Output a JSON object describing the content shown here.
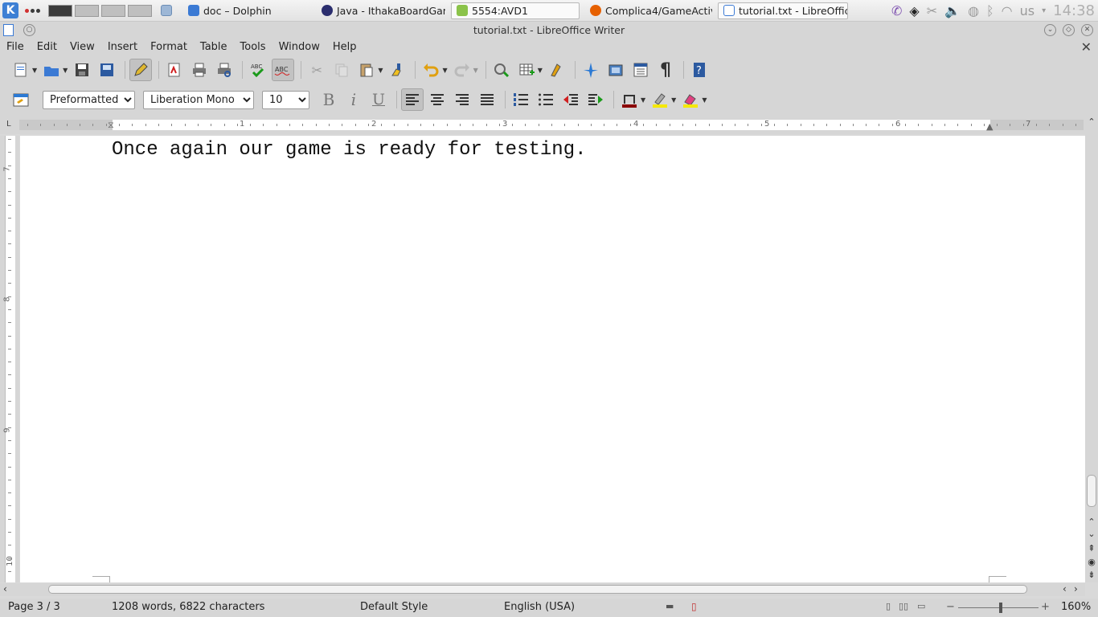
{
  "taskbar": {
    "tasks": [
      {
        "label": "doc – Dolphin",
        "icon": "folder-icon",
        "color": "#3b7ad4"
      },
      {
        "label": "Java - IthakaBoardGam",
        "icon": "eclipse-icon",
        "color": "#2b2e6e"
      },
      {
        "label": "5554:AVD1",
        "icon": "android-icon",
        "color": "#8bc34a"
      },
      {
        "label": "Complica4/GameActivi",
        "icon": "firefox-icon",
        "color": "#e66000"
      },
      {
        "label": "tutorial.txt - LibreOffic",
        "icon": "writer-icon",
        "color": "#3b7ad4"
      }
    ],
    "tray": {
      "language": "us",
      "clock": "14:38"
    }
  },
  "window": {
    "title": "tutorial.txt - LibreOffice Writer"
  },
  "menu": [
    "File",
    "Edit",
    "View",
    "Insert",
    "Format",
    "Table",
    "Tools",
    "Window",
    "Help"
  ],
  "formatting": {
    "paragraph_style": "Preformatted Te",
    "font_name": "Liberation Mono",
    "font_size": "10"
  },
  "ruler": {
    "horizontal_numbers": [
      "1",
      "2",
      "3",
      "4",
      "5",
      "6",
      "7"
    ],
    "vertical_numbers": [
      "7",
      "8",
      "9",
      "10"
    ]
  },
  "document": {
    "line": "Once again our game is ready for testing."
  },
  "status": {
    "page": "Page 3 / 3",
    "words": "1208 words, 6822 characters",
    "style": "Default Style",
    "language": "English (USA)",
    "zoom": "160%"
  },
  "colors": {
    "accent": "#3b7ad4",
    "toolbar_bg": "#d6d6d6"
  }
}
